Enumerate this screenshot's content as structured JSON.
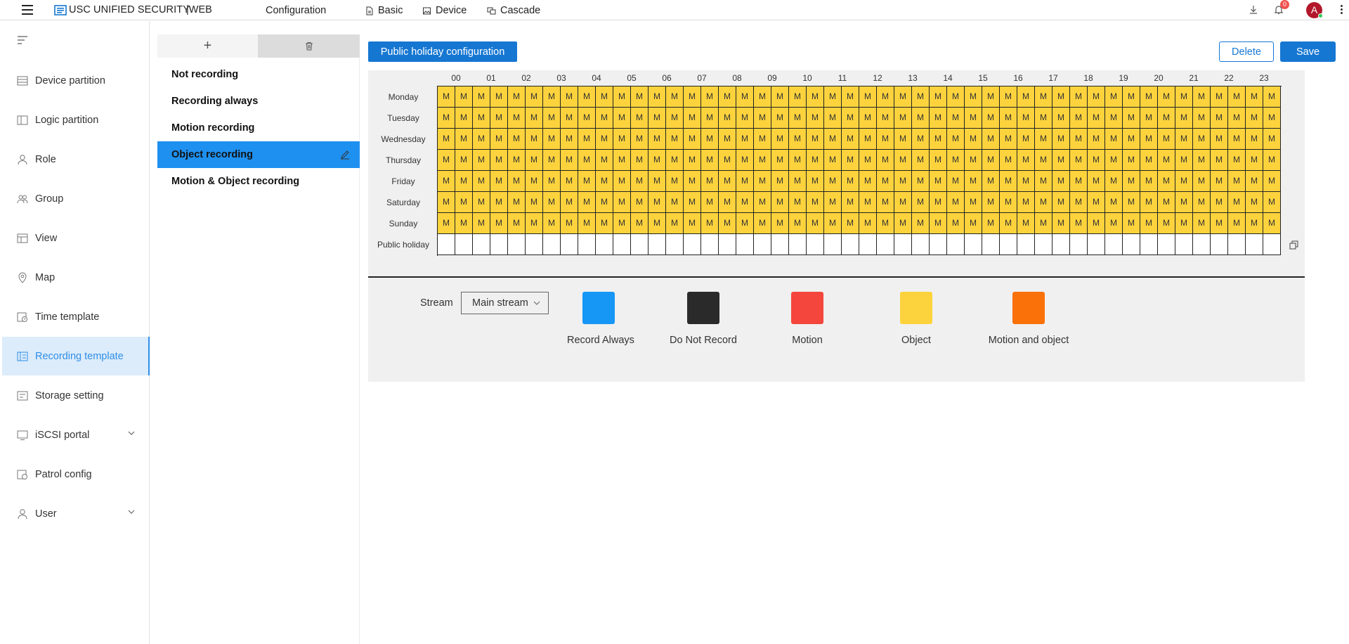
{
  "header": {
    "app_name": "USC UNIFIED SECURITY",
    "app_suffix": "|WEB",
    "section_title": "Configuration",
    "nav": [
      {
        "label": "Basic",
        "icon": "document-icon"
      },
      {
        "label": "Device",
        "icon": "image-icon"
      },
      {
        "label": "Cascade",
        "icon": "cascade-icon"
      }
    ],
    "notification_count": "0",
    "avatar_letter": "A"
  },
  "sidebar": {
    "items": [
      {
        "label": "Device partition",
        "icon": "partition-icon"
      },
      {
        "label": "Logic partition",
        "icon": "logic-partition-icon"
      },
      {
        "label": "Role",
        "icon": "user-icon"
      },
      {
        "label": "Group",
        "icon": "group-icon"
      },
      {
        "label": "View",
        "icon": "view-icon"
      },
      {
        "label": "Map",
        "icon": "map-pin-icon"
      },
      {
        "label": "Time template",
        "icon": "time-template-icon"
      },
      {
        "label": "Recording template",
        "icon": "recording-template-icon",
        "active": true
      },
      {
        "label": "Storage setting",
        "icon": "storage-icon"
      },
      {
        "label": "iSCSI portal",
        "icon": "monitor-icon",
        "expandable": true
      },
      {
        "label": "Patrol config",
        "icon": "patrol-icon"
      },
      {
        "label": "User",
        "icon": "user-icon",
        "expandable": true
      }
    ]
  },
  "templates": {
    "add_label": "+",
    "items": [
      {
        "label": "Not recording"
      },
      {
        "label": "Recording always"
      },
      {
        "label": "Motion recording"
      },
      {
        "label": "Object recording",
        "active": true
      },
      {
        "label": "Motion & Object recording"
      }
    ]
  },
  "toolbar": {
    "holiday_button": "Public holiday configuration",
    "delete_button": "Delete",
    "save_button": "Save"
  },
  "schedule": {
    "hours": [
      "00",
      "01",
      "02",
      "03",
      "04",
      "05",
      "06",
      "07",
      "08",
      "09",
      "10",
      "11",
      "12",
      "13",
      "14",
      "15",
      "16",
      "17",
      "18",
      "19",
      "20",
      "21",
      "22",
      "23"
    ],
    "days": [
      "Monday",
      "Tuesday",
      "Wednesday",
      "Thursday",
      "Friday",
      "Saturday",
      "Sunday",
      "Public holiday"
    ],
    "cell_mark": "M",
    "filled_days": 7,
    "fill_color": "#fdd33d"
  },
  "legend": {
    "stream_label": "Stream",
    "stream_value": "Main stream",
    "items": [
      {
        "label": "Record Always",
        "color": "#1697f6"
      },
      {
        "label": "Do Not Record",
        "color": "#2a2a2a"
      },
      {
        "label": "Motion",
        "color": "#f4463c"
      },
      {
        "label": "Object",
        "color": "#fdd33d"
      },
      {
        "label": "Motion and object",
        "color": "#fb7109"
      }
    ]
  }
}
